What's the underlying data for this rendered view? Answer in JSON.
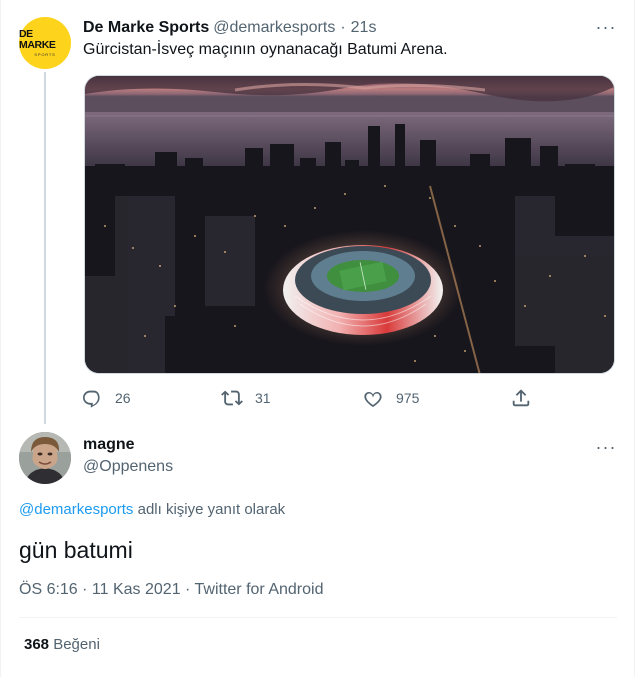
{
  "parent_tweet": {
    "avatar_logo": {
      "main": "DE MARKE",
      "sub": "SPORTS"
    },
    "display_name": "De Marke Sports",
    "handle": "@demarkesports",
    "separator": "·",
    "time": "21s",
    "more": "···",
    "text": "Gürcistan-İsveç maçının oynanacağı Batumi Arena.",
    "actions": {
      "reply_count": "26",
      "retweet_count": "31",
      "like_count": "975"
    }
  },
  "reply_tweet": {
    "display_name": "magne",
    "handle": "@Oppenens",
    "more": "···",
    "reply_to": {
      "mention": "@demarkesports",
      "suffix": " adlı kişiye yanıt olarak"
    },
    "text": "gün batumi",
    "meta": "ÖS 6:16 · 11 Kas 2021 · Twitter for Android",
    "likes": {
      "count": "368",
      "label": " Beğeni"
    }
  },
  "colors": {
    "text_primary": "#0f1419",
    "text_secondary": "#536471",
    "link": "#1d9bf0",
    "brand_yellow": "#fdd31c",
    "divider": "#eff3f4"
  },
  "icons": [
    "reply-icon",
    "retweet-icon",
    "like-icon",
    "share-icon",
    "more-icon"
  ]
}
